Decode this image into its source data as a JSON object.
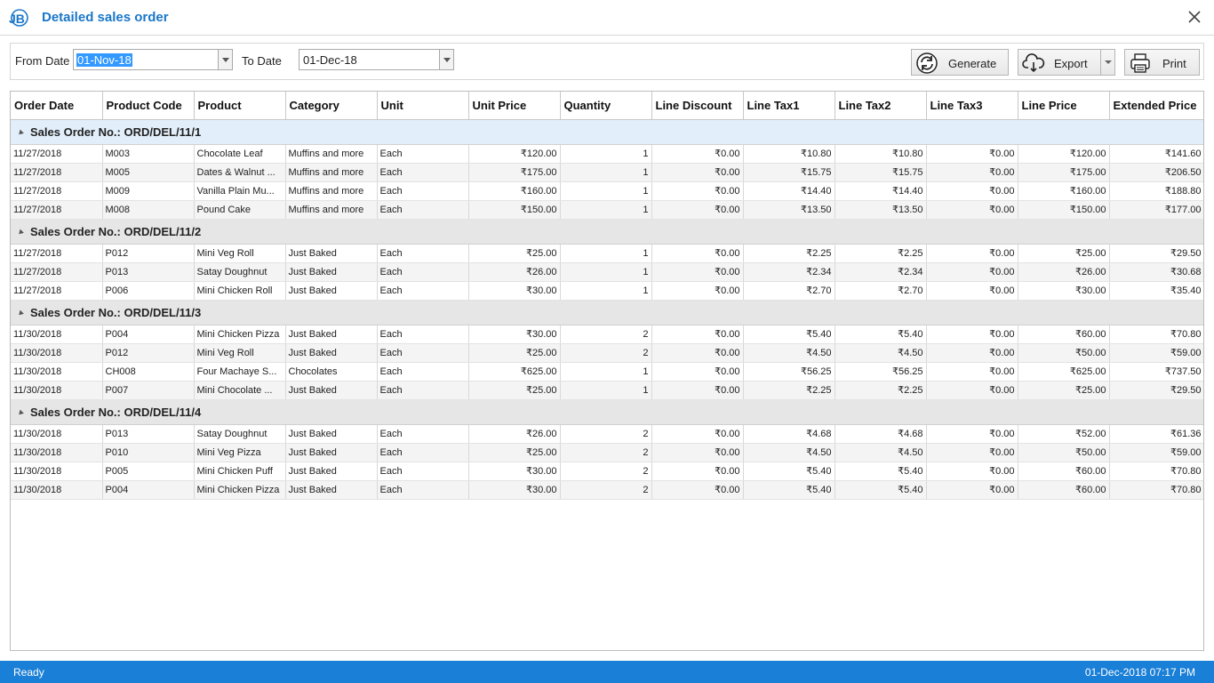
{
  "window": {
    "title": "Detailed sales order",
    "logo_text": "JB"
  },
  "toolbar": {
    "from_label": "From Date",
    "from_value": "01-Nov-18",
    "to_label": "To Date",
    "to_value": "01-Dec-18",
    "generate_label": "Generate",
    "export_label": "Export",
    "print_label": "Print"
  },
  "grid": {
    "columns": [
      "Order Date",
      "Product Code",
      "Product",
      "Category",
      "Unit",
      "Unit Price",
      "Quantity",
      "Line Discount",
      "Line Tax1",
      "Line Tax2",
      "Line Tax3",
      "Line Price",
      "Extended Price"
    ],
    "groups": [
      {
        "label": "Sales Order No.: ORD/DEL/11/1",
        "rows": [
          [
            "11/27/2018",
            "M003",
            "Chocolate Leaf",
            "Muffins and more",
            "Each",
            "₹120.00",
            "1",
            "₹0.00",
            "₹10.80",
            "₹10.80",
            "₹0.00",
            "₹120.00",
            "₹141.60"
          ],
          [
            "11/27/2018",
            "M005",
            "Dates & Walnut ...",
            "Muffins and more",
            "Each",
            "₹175.00",
            "1",
            "₹0.00",
            "₹15.75",
            "₹15.75",
            "₹0.00",
            "₹175.00",
            "₹206.50"
          ],
          [
            "11/27/2018",
            "M009",
            "Vanilla Plain Mu...",
            "Muffins and more",
            "Each",
            "₹160.00",
            "1",
            "₹0.00",
            "₹14.40",
            "₹14.40",
            "₹0.00",
            "₹160.00",
            "₹188.80"
          ],
          [
            "11/27/2018",
            "M008",
            "Pound Cake",
            "Muffins and more",
            "Each",
            "₹150.00",
            "1",
            "₹0.00",
            "₹13.50",
            "₹13.50",
            "₹0.00",
            "₹150.00",
            "₹177.00"
          ]
        ]
      },
      {
        "label": "Sales Order No.: ORD/DEL/11/2",
        "rows": [
          [
            "11/27/2018",
            "P012",
            "Mini Veg Roll",
            "Just Baked",
            "Each",
            "₹25.00",
            "1",
            "₹0.00",
            "₹2.25",
            "₹2.25",
            "₹0.00",
            "₹25.00",
            "₹29.50"
          ],
          [
            "11/27/2018",
            "P013",
            "Satay Doughnut",
            "Just Baked",
            "Each",
            "₹26.00",
            "1",
            "₹0.00",
            "₹2.34",
            "₹2.34",
            "₹0.00",
            "₹26.00",
            "₹30.68"
          ],
          [
            "11/27/2018",
            "P006",
            "Mini Chicken Roll",
            "Just Baked",
            "Each",
            "₹30.00",
            "1",
            "₹0.00",
            "₹2.70",
            "₹2.70",
            "₹0.00",
            "₹30.00",
            "₹35.40"
          ]
        ]
      },
      {
        "label": "Sales Order No.: ORD/DEL/11/3",
        "rows": [
          [
            "11/30/2018",
            "P004",
            "Mini Chicken Pizza",
            "Just Baked",
            "Each",
            "₹30.00",
            "2",
            "₹0.00",
            "₹5.40",
            "₹5.40",
            "₹0.00",
            "₹60.00",
            "₹70.80"
          ],
          [
            "11/30/2018",
            "P012",
            "Mini Veg Roll",
            "Just Baked",
            "Each",
            "₹25.00",
            "2",
            "₹0.00",
            "₹4.50",
            "₹4.50",
            "₹0.00",
            "₹50.00",
            "₹59.00"
          ],
          [
            "11/30/2018",
            "CH008",
            "Four Machaye S...",
            "Chocolates",
            "Each",
            "₹625.00",
            "1",
            "₹0.00",
            "₹56.25",
            "₹56.25",
            "₹0.00",
            "₹625.00",
            "₹737.50"
          ],
          [
            "11/30/2018",
            "P007",
            "Mini Chocolate ...",
            "Just Baked",
            "Each",
            "₹25.00",
            "1",
            "₹0.00",
            "₹2.25",
            "₹2.25",
            "₹0.00",
            "₹25.00",
            "₹29.50"
          ]
        ]
      },
      {
        "label": "Sales Order No.: ORD/DEL/11/4",
        "rows": [
          [
            "11/30/2018",
            "P013",
            "Satay Doughnut",
            "Just Baked",
            "Each",
            "₹26.00",
            "2",
            "₹0.00",
            "₹4.68",
            "₹4.68",
            "₹0.00",
            "₹52.00",
            "₹61.36"
          ],
          [
            "11/30/2018",
            "P010",
            "Mini Veg Pizza",
            "Just Baked",
            "Each",
            "₹25.00",
            "2",
            "₹0.00",
            "₹4.50",
            "₹4.50",
            "₹0.00",
            "₹50.00",
            "₹59.00"
          ],
          [
            "11/30/2018",
            "P005",
            "Mini Chicken Puff",
            "Just Baked",
            "Each",
            "₹30.00",
            "2",
            "₹0.00",
            "₹5.40",
            "₹5.40",
            "₹0.00",
            "₹60.00",
            "₹70.80"
          ],
          [
            "11/30/2018",
            "P004",
            "Mini Chicken Pizza",
            "Just Baked",
            "Each",
            "₹30.00",
            "2",
            "₹0.00",
            "₹5.40",
            "₹5.40",
            "₹0.00",
            "₹60.00",
            "₹70.80"
          ]
        ]
      }
    ]
  },
  "status": {
    "left": "Ready",
    "right": "01-Dec-2018 07:17 PM"
  },
  "colors": {
    "accent": "#1a77c9",
    "statusbar": "#1a7fd6",
    "group_header": "#e6e6e6",
    "selected_group_header": "#e2eef9"
  },
  "icons": {
    "logo": "jb-logo-icon",
    "close": "close-icon",
    "generate": "refresh-icon",
    "export": "cloud-download-icon",
    "print": "printer-icon"
  }
}
